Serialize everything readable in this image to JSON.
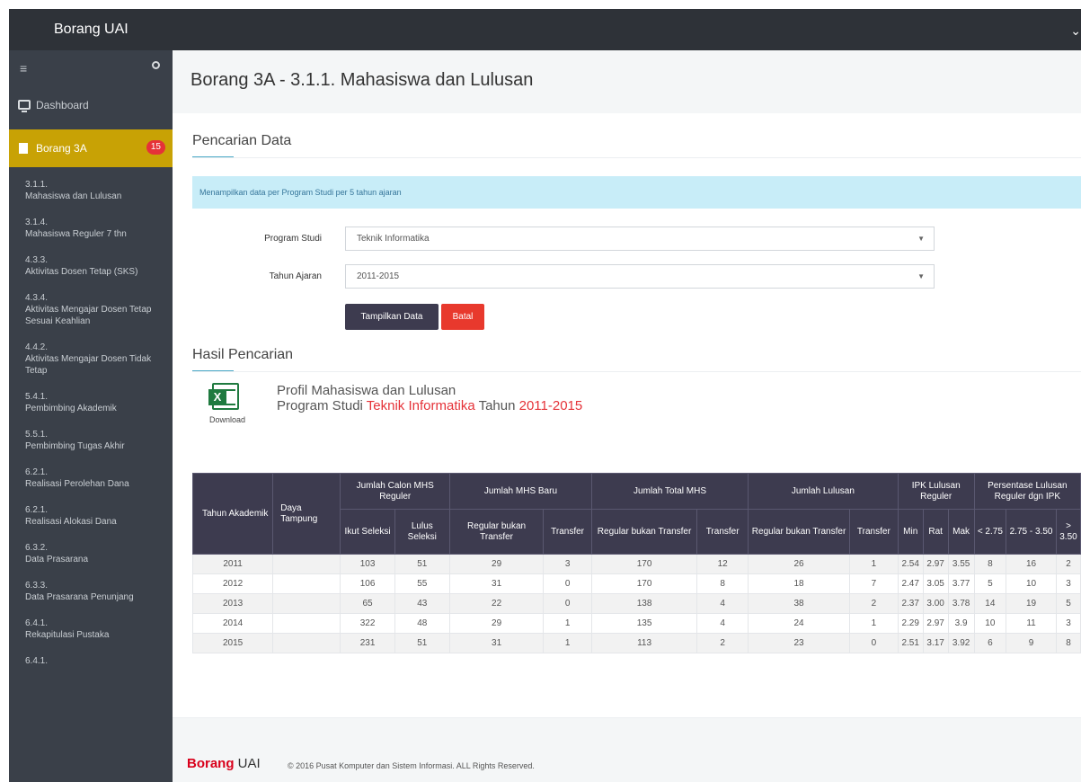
{
  "app": {
    "brand": "Borang UAI"
  },
  "sidebar": {
    "dashboard_label": "Dashboard",
    "active_label": "Borang 3A",
    "active_badge": "15",
    "items": [
      {
        "code": "3.1.1.",
        "label": "Mahasiswa dan Lulusan"
      },
      {
        "code": "3.1.4.",
        "label": "Mahasiswa Reguler 7 thn"
      },
      {
        "code": "4.3.3.",
        "label": "Aktivitas Dosen Tetap (SKS)"
      },
      {
        "code": "4.3.4.",
        "label": "Aktivitas Mengajar Dosen Tetap Sesuai Keahlian"
      },
      {
        "code": "4.4.2.",
        "label": "Aktivitas Mengajar Dosen Tidak Tetap"
      },
      {
        "code": "5.4.1.",
        "label": "Pembimbing Akademik"
      },
      {
        "code": "5.5.1.",
        "label": "Pembimbing Tugas Akhir"
      },
      {
        "code": "6.2.1.",
        "label": "Realisasi Perolehan Dana"
      },
      {
        "code": "6.2.1.",
        "label": "Realisasi Alokasi Dana"
      },
      {
        "code": "6.3.2.",
        "label": "Data Prasarana"
      },
      {
        "code": "6.3.3.",
        "label": "Data Prasarana Penunjang"
      },
      {
        "code": "6.4.1.",
        "label": "Rekapitulasi Pustaka"
      },
      {
        "code": "6.4.1.",
        "label": ""
      }
    ]
  },
  "main": {
    "page_title": "Borang 3A - 3.1.1. Mahasiswa dan Lulusan",
    "search_title": "Pencarian Data",
    "info_text": "Menampilkan data per Program Studi per 5 tahun ajaran",
    "program_label": "Program Studi",
    "program_value": "Teknik Informatika",
    "tahun_label": "Tahun Ajaran",
    "tahun_value": "2011-2015",
    "show_button": "Tampilkan Data",
    "cancel_button": "Batal",
    "result_title": "Hasil Pencarian",
    "download_label": "Download",
    "profile_line1": "Profil Mahasiswa dan Lulusan",
    "profile_prefix": "Program Studi ",
    "profile_program": "Teknik Informatika",
    "profile_tahun_word": " Tahun ",
    "profile_year": "2011-2015"
  },
  "table": {
    "headers": {
      "tahun": "Tahun Akademik",
      "daya": "Daya Tampung",
      "calon": "Jumlah Calon MHS Reguler",
      "baru": "Jumlah MHS Baru",
      "total": "Jumlah Total MHS",
      "lulusan": "Jumlah Lulusan",
      "ipk": "IPK Lulusan Reguler",
      "persen": "Persentase Lulusan Reguler dgn IPK",
      "ikut": "Ikut Seleksi",
      "lulus": "Lulus Seleksi",
      "reg": "Regular bukan Transfer",
      "transfer": "Transfer",
      "min": "Min",
      "rat": "Rat",
      "mak": "Mak",
      "p1": "< 2.75",
      "p2": "2.75 - 3.50",
      "p3": "> 3.50"
    },
    "rows": [
      {
        "tahun": "2011",
        "daya": "",
        "ikut": "103",
        "lulus": "51",
        "baru_reg": "29",
        "baru_tr": "3",
        "total_reg": "170",
        "total_tr": "12",
        "lul_reg": "26",
        "lul_tr": "1",
        "min": "2.54",
        "rat": "2.97",
        "mak": "3.55",
        "p1": "8",
        "p2": "16",
        "p3": "2"
      },
      {
        "tahun": "2012",
        "daya": "",
        "ikut": "106",
        "lulus": "55",
        "baru_reg": "31",
        "baru_tr": "0",
        "total_reg": "170",
        "total_tr": "8",
        "lul_reg": "18",
        "lul_tr": "7",
        "min": "2.47",
        "rat": "3.05",
        "mak": "3.77",
        "p1": "5",
        "p2": "10",
        "p3": "3"
      },
      {
        "tahun": "2013",
        "daya": "",
        "ikut": "65",
        "lulus": "43",
        "baru_reg": "22",
        "baru_tr": "0",
        "total_reg": "138",
        "total_tr": "4",
        "lul_reg": "38",
        "lul_tr": "2",
        "min": "2.37",
        "rat": "3.00",
        "mak": "3.78",
        "p1": "14",
        "p2": "19",
        "p3": "5"
      },
      {
        "tahun": "2014",
        "daya": "",
        "ikut": "322",
        "lulus": "48",
        "baru_reg": "29",
        "baru_tr": "1",
        "total_reg": "135",
        "total_tr": "4",
        "lul_reg": "24",
        "lul_tr": "1",
        "min": "2.29",
        "rat": "2.97",
        "mak": "3.9",
        "p1": "10",
        "p2": "11",
        "p3": "3"
      },
      {
        "tahun": "2015",
        "daya": "",
        "ikut": "231",
        "lulus": "51",
        "baru_reg": "31",
        "baru_tr": "1",
        "total_reg": "113",
        "total_tr": "2",
        "lul_reg": "23",
        "lul_tr": "0",
        "min": "2.51",
        "rat": "3.17",
        "mak": "3.92",
        "p1": "6",
        "p2": "9",
        "p3": "8"
      }
    ]
  },
  "footer": {
    "brand_bold": "Borang",
    "brand_rest": " UAI",
    "copyright": "© 2016 Pusat Komputer dan Sistem Informasi. ALL Rights Reserved."
  }
}
